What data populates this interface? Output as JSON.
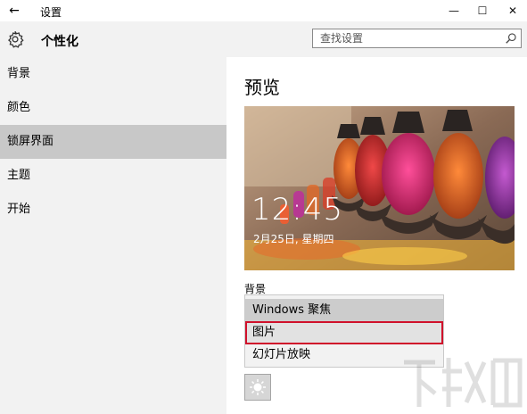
{
  "window": {
    "title": "设置",
    "back_icon": "←",
    "minimize_icon": "—",
    "maximize_icon": "☐",
    "close_icon": "✕"
  },
  "header": {
    "title": "个性化",
    "search_placeholder": "查找设置"
  },
  "sidebar": {
    "items": [
      {
        "label": "背景"
      },
      {
        "label": "颜色"
      },
      {
        "label": "锁屏界面",
        "selected": true
      },
      {
        "label": "主题"
      },
      {
        "label": "开始"
      }
    ]
  },
  "main": {
    "title": "预览",
    "preview": {
      "time": "12:45",
      "date": "2月25日, 星期四"
    },
    "background_label": "背景",
    "dropdown_options": [
      {
        "label": "Windows 聚焦"
      },
      {
        "label": "图片",
        "selected": true
      },
      {
        "label": "幻灯片放映"
      }
    ]
  },
  "colors": {
    "accent_highlight": "#d0112b",
    "sidebar_bg": "#f2f2f2",
    "selected_bg": "#c8c8c8"
  }
}
